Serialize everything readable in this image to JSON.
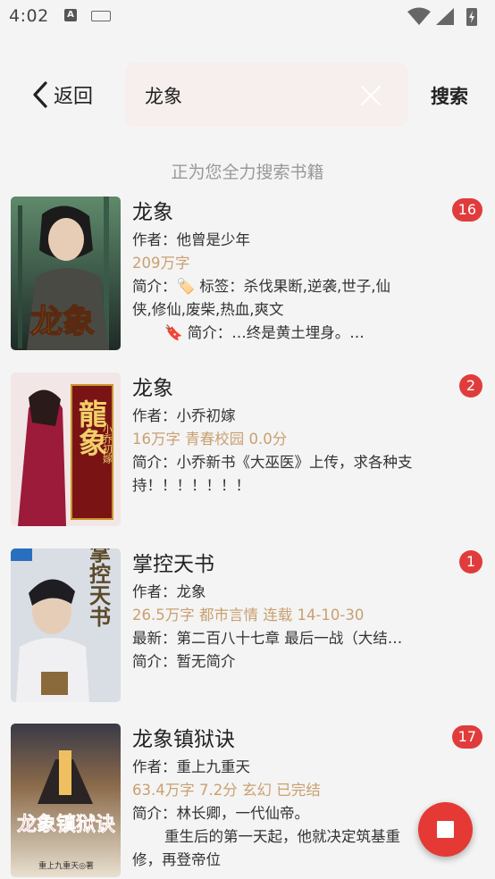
{
  "status_bar": {
    "time": "4:02",
    "keyboard_icon_letter": "A"
  },
  "header": {
    "back_label": "返回",
    "search_value": "龙象",
    "search_button": "搜索"
  },
  "status_text": "正为您全力搜索书籍",
  "results": [
    {
      "title": "龙象",
      "author": "作者：他曾是少年",
      "meta": "209万字",
      "desc_1": "简介：🏷️  标签：杀伐果断,逆袭,世子,仙",
      "desc_2": "侠,修仙,废柴,热血,爽文",
      "desc_3": "🔖  简介：…终是黄土埋身。…",
      "count": "16",
      "cover_text": "龙象"
    },
    {
      "title": "龙象",
      "author": "作者：小乔初嫁",
      "meta": "16万字  青春校园  0.0分",
      "desc_1": "简介：小乔新书《大巫医》上传，求各种支",
      "desc_2": "持！！！！！！！",
      "count": "2",
      "cover_text": "龍象",
      "cover_sub": "小乔初嫁"
    },
    {
      "title": "掌控天书",
      "author": "作者：龙象",
      "meta": "26.5万字  都市言情  连载  14-10-30",
      "latest": "最新：第二百八十七章 最后一战（大结…",
      "desc_1": "简介：暂无简介",
      "count": "1",
      "cover_text": "掌控天书"
    },
    {
      "title": "龙象镇狱诀",
      "author": "作者：重上九重天",
      "meta": "63.4万字  7.2分  玄幻  已完结",
      "desc_1": "简介：林长卿，一代仙帝。",
      "desc_2": "重生后的第一天起，他就决定筑基重",
      "desc_3": "修，再登帝位",
      "count": "17",
      "cover_text": "龙象镇狱诀",
      "cover_sub": "重上九重天◎著"
    }
  ],
  "colors": {
    "accent": "#e53935",
    "badge": "#e03c3c",
    "meta": "#c9a070",
    "search_bg": "#f7eeee"
  }
}
